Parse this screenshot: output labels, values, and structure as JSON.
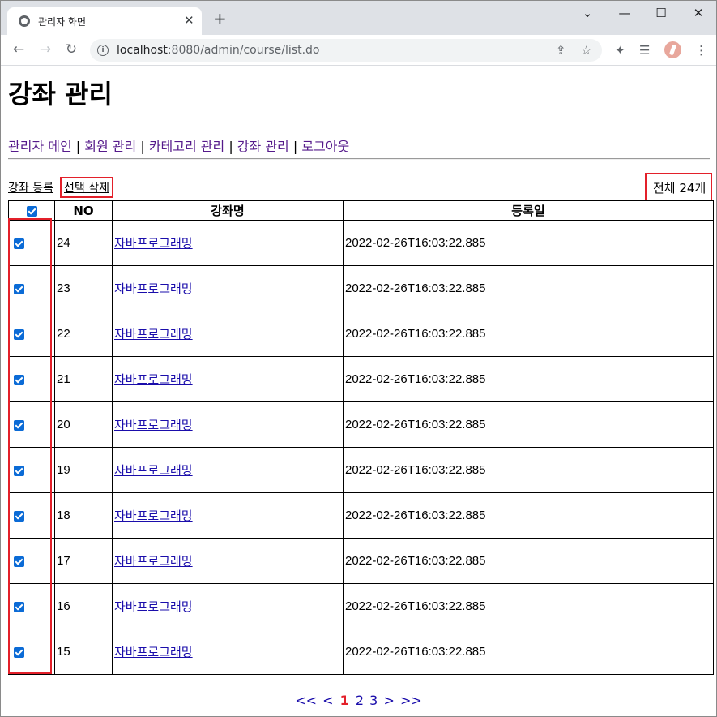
{
  "browser": {
    "tab_title": "관리자 화면",
    "url_host": "localhost",
    "url_rest": ":8080/admin/course/list.do"
  },
  "page": {
    "title": "강좌 관리",
    "nav": [
      "관리자 메인",
      "회원 관리",
      "카테고리 관리",
      "강좌 관리",
      "로그아웃"
    ],
    "nav_separator": "|",
    "actions": {
      "register": "강좌 등록",
      "delete_selected": "선택 삭제"
    },
    "total": "전체 24개",
    "table": {
      "headers": {
        "no": "NO",
        "name": "강좌명",
        "date": "등록일"
      },
      "rows": [
        {
          "no": "24",
          "name": "자바프로그래밍",
          "date": "2022-02-26T16:03:22.885"
        },
        {
          "no": "23",
          "name": "자바프로그래밍",
          "date": "2022-02-26T16:03:22.885"
        },
        {
          "no": "22",
          "name": "자바프로그래밍",
          "date": "2022-02-26T16:03:22.885"
        },
        {
          "no": "21",
          "name": "자바프로그래밍",
          "date": "2022-02-26T16:03:22.885"
        },
        {
          "no": "20",
          "name": "자바프로그래밍",
          "date": "2022-02-26T16:03:22.885"
        },
        {
          "no": "19",
          "name": "자바프로그래밍",
          "date": "2022-02-26T16:03:22.885"
        },
        {
          "no": "18",
          "name": "자바프로그래밍",
          "date": "2022-02-26T16:03:22.885"
        },
        {
          "no": "17",
          "name": "자바프로그래밍",
          "date": "2022-02-26T16:03:22.885"
        },
        {
          "no": "16",
          "name": "자바프로그래밍",
          "date": "2022-02-26T16:03:22.885"
        },
        {
          "no": "15",
          "name": "자바프로그래밍",
          "date": "2022-02-26T16:03:22.885"
        }
      ]
    },
    "pager": {
      "first": "<<",
      "prev": "<",
      "pages": [
        "1",
        "2",
        "3"
      ],
      "current": "1",
      "next": ">",
      "last": ">>"
    }
  },
  "colors": {
    "highlight": "#e3202a",
    "checkbox": "#0b6bd6",
    "link": "#1a0dab",
    "visited": "#551a8b"
  }
}
